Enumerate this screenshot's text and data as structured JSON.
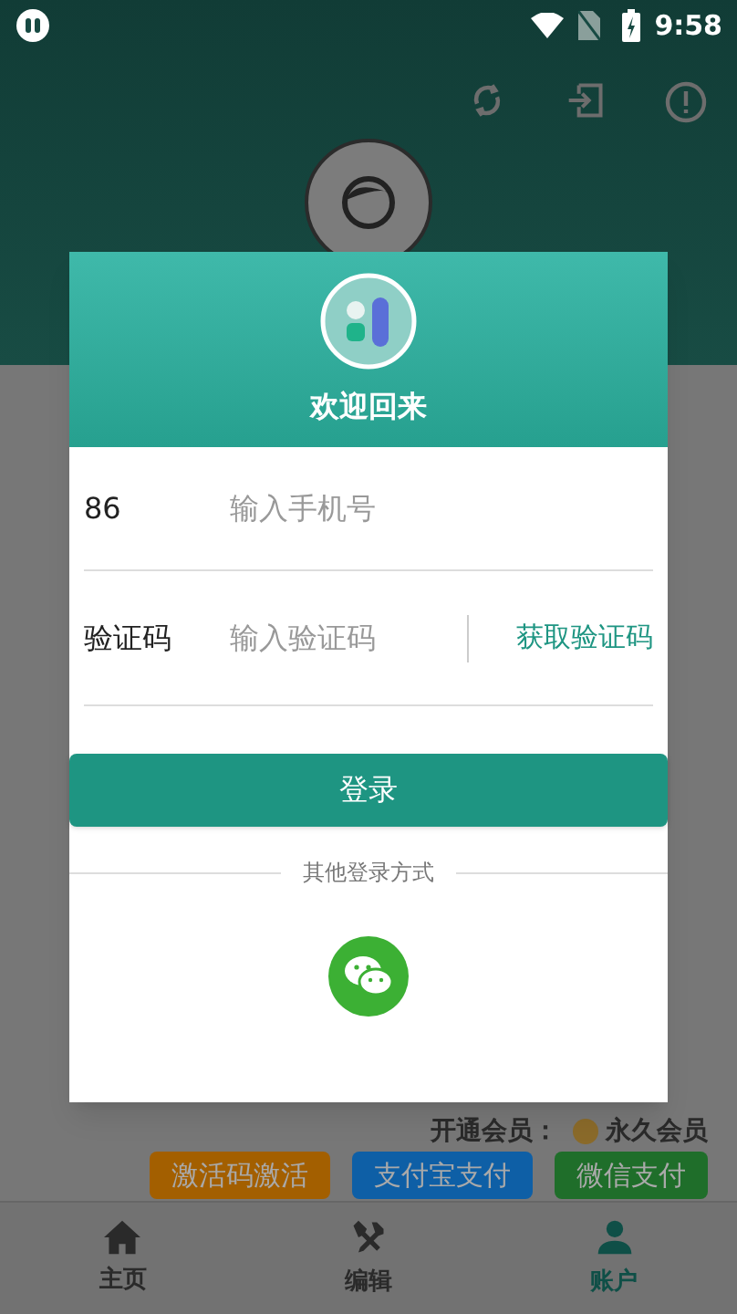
{
  "status_bar": {
    "time": "9:58"
  },
  "membership": {
    "label": "开通会员：",
    "plan": "永久会员"
  },
  "pay_buttons": [
    {
      "label": "激活码激活",
      "color": "#a35f00"
    },
    {
      "label": "支付宝支付",
      "color": "#0e5fa6"
    },
    {
      "label": "微信支付",
      "color": "#1f6e2a"
    }
  ],
  "bottom_nav": [
    {
      "label": "主页",
      "kind": "home",
      "selected": false
    },
    {
      "label": "编辑",
      "kind": "tools",
      "selected": false
    },
    {
      "label": "账户",
      "kind": "account",
      "selected": true
    }
  ],
  "dialog": {
    "title": "欢迎回来",
    "country_code": "86",
    "phone_placeholder": "输入手机号",
    "code_label": "验证码",
    "code_placeholder": "输入验证码",
    "get_code": "获取验证码",
    "login": "登录",
    "other_methods": "其他登录方式"
  }
}
